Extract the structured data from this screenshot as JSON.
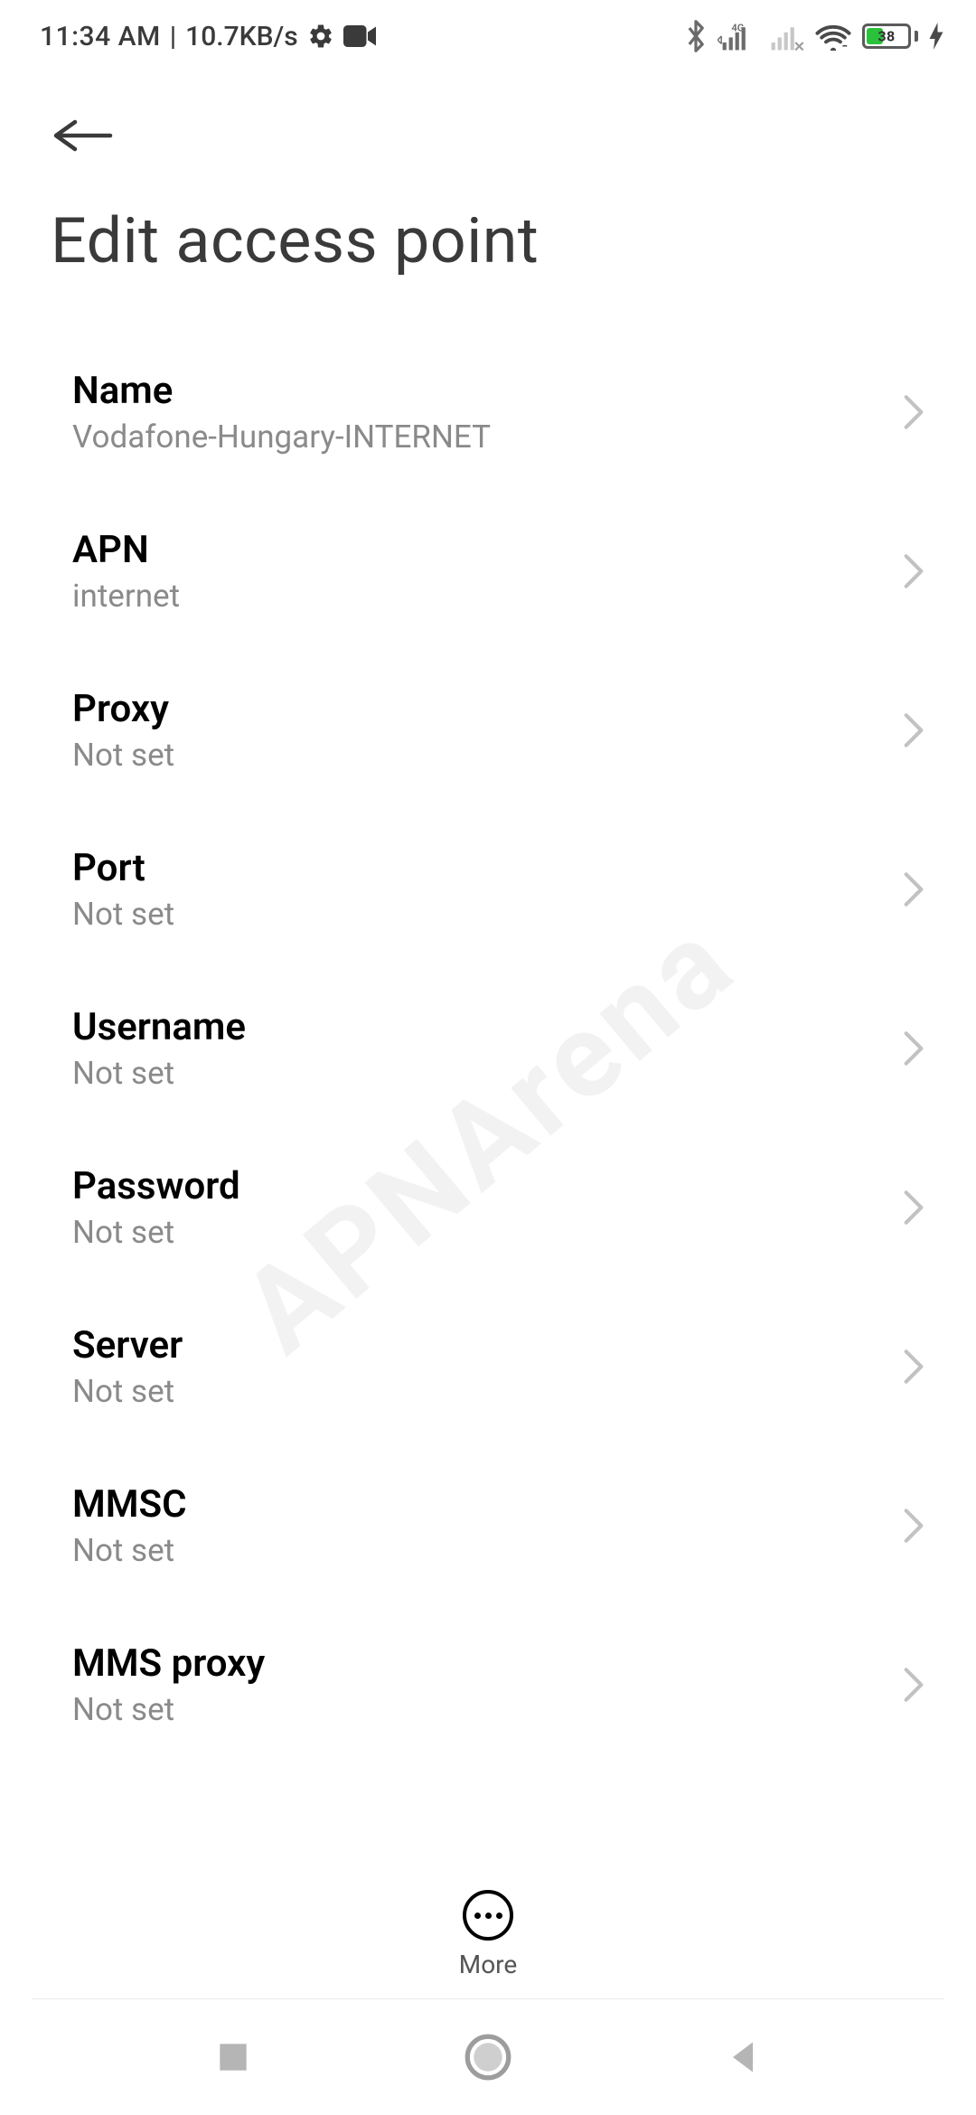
{
  "status": {
    "time": "11:34 AM",
    "net_speed": "10.7KB/s",
    "network_type": "4G",
    "battery_percent": "38"
  },
  "header": {
    "title": "Edit access point"
  },
  "list": {
    "items": [
      {
        "label": "Name",
        "value": "Vodafone-Hungary-INTERNET"
      },
      {
        "label": "APN",
        "value": "internet"
      },
      {
        "label": "Proxy",
        "value": "Not set"
      },
      {
        "label": "Port",
        "value": "Not set"
      },
      {
        "label": "Username",
        "value": "Not set"
      },
      {
        "label": "Password",
        "value": "Not set"
      },
      {
        "label": "Server",
        "value": "Not set"
      },
      {
        "label": "MMSC",
        "value": "Not set"
      },
      {
        "label": "MMS proxy",
        "value": "Not set"
      }
    ]
  },
  "more": {
    "label": "More"
  }
}
